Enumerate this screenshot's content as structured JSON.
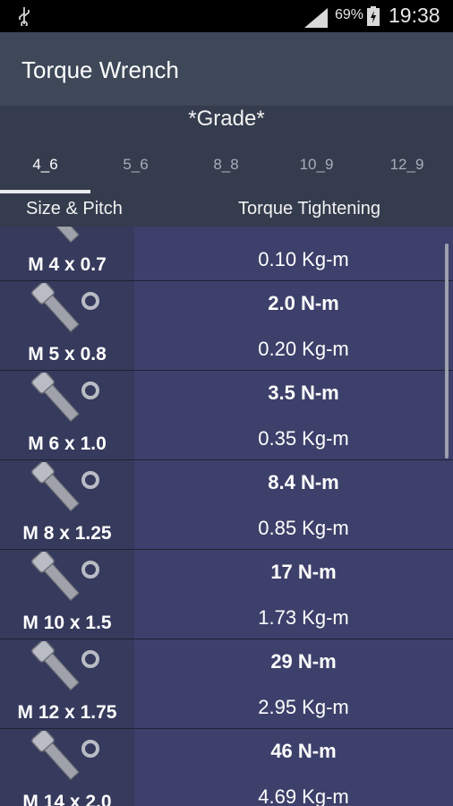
{
  "status_bar": {
    "battery_percent": "69%",
    "time": "19:38",
    "icons": [
      "usb-icon",
      "signal-icon",
      "battery-charging-icon"
    ]
  },
  "app": {
    "title": "Torque Wrench"
  },
  "grade": {
    "title": "*Grade*",
    "tabs": [
      "4_6",
      "5_6",
      "8_8",
      "10_9",
      "12_9"
    ],
    "selected": "4_6"
  },
  "columns": {
    "size": "Size & Pitch",
    "torque": "Torque Tightening"
  },
  "rows": [
    {
      "size": "M 4 x 0.7",
      "nm": "",
      "kgm": "0.10 Kg-m"
    },
    {
      "size": "M 5 x 0.8",
      "nm": "2.0 N-m",
      "kgm": "0.20 Kg-m"
    },
    {
      "size": "M 6 x 1.0",
      "nm": "3.5 N-m",
      "kgm": "0.35 Kg-m"
    },
    {
      "size": "M 8 x 1.25",
      "nm": "8.4 N-m",
      "kgm": "0.85 Kg-m"
    },
    {
      "size": "M 10 x 1.5",
      "nm": "17 N-m",
      "kgm": "1.73 Kg-m"
    },
    {
      "size": "M 12 x 1.75",
      "nm": "29 N-m",
      "kgm": "2.95 Kg-m"
    },
    {
      "size": "M 14 x 2.0",
      "nm": "46 N-m",
      "kgm": "4.69 Kg-m"
    }
  ]
}
